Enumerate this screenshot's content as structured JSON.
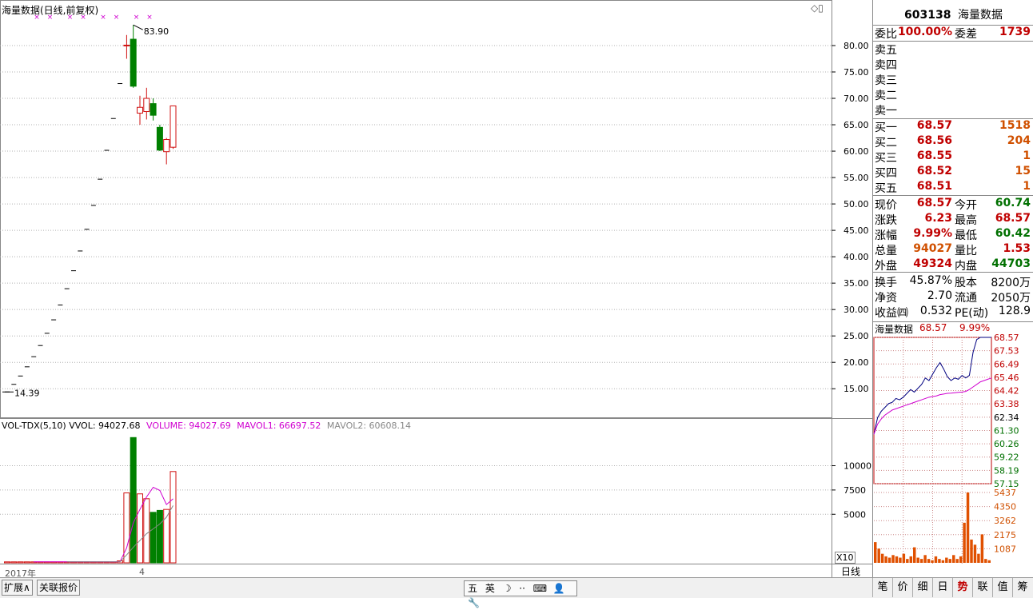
{
  "header": {
    "title": "海量数据(日线,前复权)",
    "vol_line": {
      "label": "VOL-TDX(5,10)",
      "vvol": "VVOL: 94027.68",
      "volume": "VOLUME: 94027.69",
      "mavol1": "MAVOL1: 66697.52",
      "mavol2": "MAVOL2: 60608.14"
    },
    "x10": "X10",
    "year_label": "2017年",
    "month_label": "4"
  },
  "colors": {
    "up": "#d01010",
    "down": "#008000",
    "ma": "#d000d0",
    "grid": "#b0b0b0",
    "price_line": "#000080",
    "avg_line": "#d000d0",
    "vol_orange": "#e05000"
  },
  "chart_data": [
    {
      "type": "candlestick",
      "title": "海量数据(日线,前复权)",
      "yticks": [
        15,
        20,
        25,
        30,
        35,
        40,
        45,
        50,
        55,
        60,
        65,
        70,
        75,
        80
      ],
      "ytick_labels": [
        "15.00",
        "20.00",
        "25.00",
        "30.00",
        "35.00",
        "40.00",
        "45.00",
        "50.00",
        "55.00",
        "60.00",
        "65.00",
        "70.00",
        "75.00",
        "80.00"
      ],
      "ylim": [
        11.4,
        85.6
      ],
      "high_label": "83.90",
      "low_label": "14.39",
      "candles": [
        {
          "o": 14.39,
          "h": 14.39,
          "l": 14.39,
          "c": 14.39
        },
        {
          "o": 15.83,
          "h": 15.83,
          "l": 15.83,
          "c": 15.83
        },
        {
          "o": 17.41,
          "h": 17.41,
          "l": 17.41,
          "c": 17.41
        },
        {
          "o": 19.15,
          "h": 19.15,
          "l": 19.15,
          "c": 19.15
        },
        {
          "o": 21.07,
          "h": 21.07,
          "l": 21.07,
          "c": 21.07
        },
        {
          "o": 23.18,
          "h": 23.18,
          "l": 23.18,
          "c": 23.18
        },
        {
          "o": 25.5,
          "h": 25.5,
          "l": 25.5,
          "c": 25.5
        },
        {
          "o": 28.05,
          "h": 28.05,
          "l": 28.05,
          "c": 28.05
        },
        {
          "o": 30.86,
          "h": 30.86,
          "l": 30.86,
          "c": 30.86
        },
        {
          "o": 33.95,
          "h": 33.95,
          "l": 33.95,
          "c": 33.95
        },
        {
          "o": 37.35,
          "h": 37.35,
          "l": 37.35,
          "c": 37.35
        },
        {
          "o": 41.09,
          "h": 41.09,
          "l": 41.09,
          "c": 41.09
        },
        {
          "o": 45.2,
          "h": 45.2,
          "l": 45.2,
          "c": 45.2
        },
        {
          "o": 49.72,
          "h": 49.72,
          "l": 49.72,
          "c": 49.72
        },
        {
          "o": 54.69,
          "h": 54.69,
          "l": 54.69,
          "c": 54.69
        },
        {
          "o": 60.16,
          "h": 60.16,
          "l": 60.16,
          "c": 60.16
        },
        {
          "o": 66.18,
          "h": 66.18,
          "l": 66.18,
          "c": 66.18
        },
        {
          "o": 72.8,
          "h": 72.8,
          "l": 72.8,
          "c": 72.8
        },
        {
          "o": 80.08,
          "h": 82.0,
          "l": 77.5,
          "c": 80.08
        },
        {
          "o": 81.2,
          "h": 83.9,
          "l": 72.0,
          "c": 72.3
        },
        {
          "o": 67.2,
          "h": 70.5,
          "l": 65.0,
          "c": 68.3
        },
        {
          "o": 67.5,
          "h": 72.0,
          "l": 66.0,
          "c": 70.0
        },
        {
          "o": 69.0,
          "h": 70.0,
          "l": 65.8,
          "c": 66.8
        },
        {
          "o": 64.5,
          "h": 65.0,
          "l": 60.0,
          "c": 60.2
        },
        {
          "o": 59.9,
          "h": 62.5,
          "l": 57.5,
          "c": 62.2
        },
        {
          "o": 60.74,
          "h": 68.57,
          "l": 60.42,
          "c": 68.57
        }
      ]
    },
    {
      "type": "bar",
      "title": "VOL-TDX(5,10)",
      "yticks": [
        5000,
        7500,
        10000
      ],
      "ytick_labels": [
        "5000",
        "7500",
        "10000"
      ],
      "ylim": [
        0,
        13500
      ],
      "values": [
        100,
        100,
        100,
        100,
        100,
        100,
        100,
        100,
        100,
        100,
        100,
        100,
        100,
        100,
        100,
        100,
        100,
        200,
        7200,
        12900,
        7100,
        6600,
        5200,
        5400,
        5500,
        9400
      ],
      "up": [
        true,
        true,
        true,
        true,
        true,
        true,
        true,
        true,
        true,
        true,
        true,
        true,
        true,
        true,
        true,
        true,
        true,
        true,
        true,
        false,
        true,
        true,
        false,
        false,
        true,
        true
      ],
      "mavol1": [
        null,
        null,
        null,
        null,
        100,
        100,
        100,
        100,
        100,
        100,
        100,
        100,
        100,
        100,
        100,
        100,
        100,
        120,
        1540,
        4120,
        5500,
        6780,
        7780,
        7460,
        6000,
        6600
      ],
      "mavol2": [
        null,
        null,
        null,
        null,
        null,
        null,
        null,
        null,
        null,
        100,
        100,
        100,
        100,
        100,
        100,
        100,
        100,
        110,
        820,
        1600,
        2300,
        3000,
        3500,
        4000,
        4700,
        5900
      ]
    },
    {
      "type": "line",
      "title": "海量数据",
      "price": "68.57",
      "change_pct": "9.99%",
      "price_ticks": [
        "68.57",
        "67.53",
        "66.49",
        "65.46",
        "64.42",
        "63.38",
        "62.34",
        "61.30",
        "60.26",
        "59.22",
        "58.19",
        "57.15"
      ],
      "vol_ticks": [
        "5437",
        "4350",
        "3262",
        "2175",
        "1087"
      ],
      "price_line": [
        61.0,
        62.3,
        62.8,
        63.1,
        63.4,
        63.5,
        63.8,
        63.7,
        63.9,
        64.2,
        64.5,
        64.3,
        64.6,
        64.9,
        65.4,
        65.2,
        65.7,
        66.2,
        66.6,
        66.1,
        65.5,
        65.2,
        65.4,
        65.3,
        65.6,
        65.4,
        65.6,
        67.4,
        68.4,
        68.57,
        68.57,
        68.57,
        68.57
      ],
      "avg_line": [
        61.0,
        61.8,
        62.2,
        62.5,
        62.7,
        62.9,
        63.0,
        63.1,
        63.2,
        63.3,
        63.4,
        63.5,
        63.6,
        63.7,
        63.8,
        63.9,
        63.95,
        64.0,
        64.1,
        64.15,
        64.2,
        64.22,
        64.25,
        64.28,
        64.3,
        64.35,
        64.5,
        64.7,
        64.9,
        65.1,
        65.2,
        65.3,
        65.4
      ],
      "volume": [
        1600,
        1100,
        700,
        500,
        400,
        600,
        500,
        400,
        700,
        300,
        500,
        1200,
        400,
        300,
        600,
        300,
        200,
        500,
        300,
        200,
        400,
        300,
        600,
        300,
        500,
        3100,
        5437,
        1800,
        1400,
        700,
        2200,
        300,
        200
      ]
    }
  ],
  "quote": {
    "code": "603138",
    "name": "海量数据",
    "weibi_label": "委比",
    "weibi": "100.00%",
    "weicha_label": "委差",
    "weicha": "1739",
    "sell": [
      {
        "label": "卖五"
      },
      {
        "label": "卖四"
      },
      {
        "label": "卖三"
      },
      {
        "label": "卖二"
      },
      {
        "label": "卖一"
      }
    ],
    "buy": [
      {
        "label": "买一",
        "price": "68.57",
        "vol": "1518"
      },
      {
        "label": "买二",
        "price": "68.56",
        "vol": "204"
      },
      {
        "label": "买三",
        "price": "68.55",
        "vol": "1"
      },
      {
        "label": "买四",
        "price": "68.52",
        "vol": "15"
      },
      {
        "label": "买五",
        "price": "68.51",
        "vol": "1"
      }
    ],
    "stats": [
      {
        "l1": "现价",
        "v1": "68.57",
        "c1": "red",
        "l2": "今开",
        "v2": "60.74",
        "c2": "green"
      },
      {
        "l1": "涨跌",
        "v1": "6.23",
        "c1": "red",
        "l2": "最高",
        "v2": "68.57",
        "c2": "red"
      },
      {
        "l1": "涨幅",
        "v1": "9.99%",
        "c1": "red",
        "l2": "最低",
        "v2": "60.42",
        "c2": "green"
      },
      {
        "l1": "总量",
        "v1": "94027",
        "c1": "orange",
        "l2": "量比",
        "v2": "1.53",
        "c2": "red"
      },
      {
        "l1": "外盘",
        "v1": "49324",
        "c1": "red",
        "l2": "内盘",
        "v2": "44703",
        "c2": "green"
      }
    ],
    "fund": [
      {
        "l1": "换手",
        "v1": "45.87%",
        "l2": "股本",
        "v2": "8200万"
      },
      {
        "l1": "净资",
        "v1": "2.70",
        "l2": "流通",
        "v2": "2050万"
      },
      {
        "l1": "收益㈣",
        "v1": "0.532",
        "l2": "PE(动)",
        "v2": "128.9"
      }
    ],
    "mini_title": "海量数据",
    "mini_price": "68.57",
    "mini_pct": "9.99%"
  },
  "bottom": {
    "tabs": [
      "扩展∧",
      "关联报价"
    ],
    "period": "日线",
    "ime": [
      "五",
      "英",
      "☽",
      "··",
      "⌨",
      "👤",
      "🔧"
    ],
    "tools": [
      "笔",
      "价",
      "细",
      "日",
      "势",
      "联",
      "值",
      "筹"
    ]
  }
}
